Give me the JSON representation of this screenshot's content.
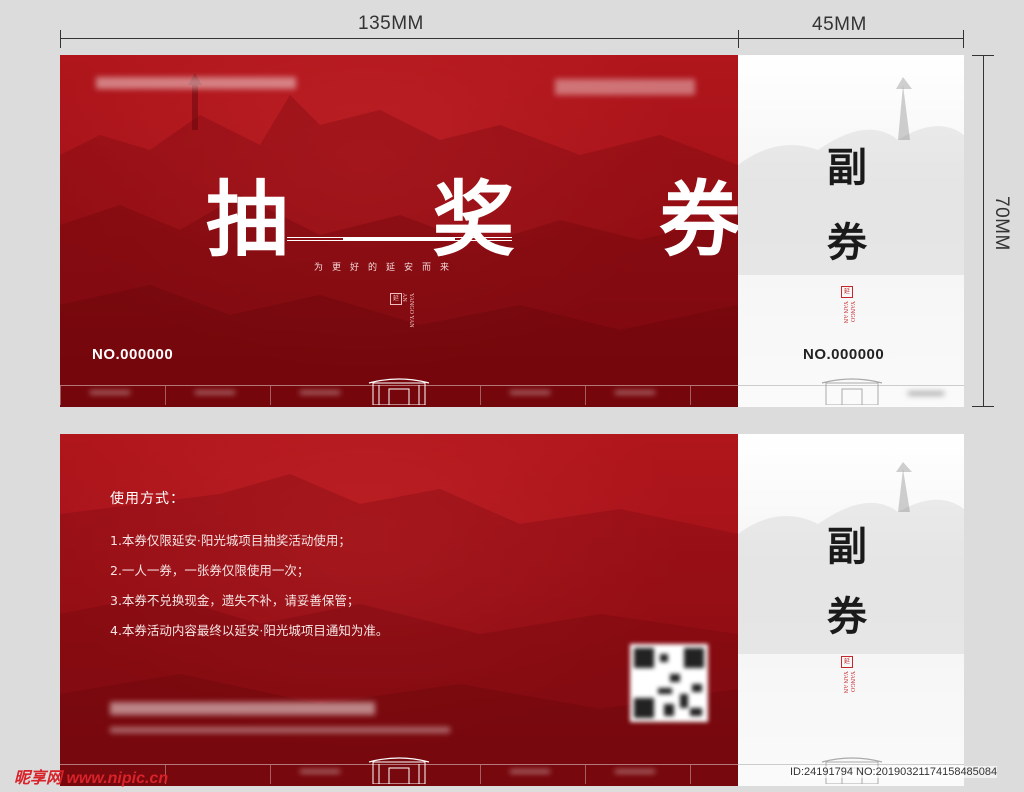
{
  "dimensions": {
    "width_main": "135MM",
    "width_stub": "45MM",
    "height": "70MM"
  },
  "front": {
    "title": "抽 奖 券",
    "subtitle": "为更好的延安而来",
    "number": "NO.000000",
    "stub_chars": [
      "副",
      "券"
    ],
    "stub_number": "NO.000000",
    "seal_text": "延",
    "seal_en": "YANGO YAN AN"
  },
  "back": {
    "usage_title": "使用方式：",
    "usage_items": [
      "1.本券仅限延安·阳光城项目抽奖活动使用；",
      "2.一人一券，一张券仅限使用一次；",
      "3.本券不兑换现金，遗失不补，请妥善保管；",
      "4.本券活动内容最终以延安·阳光城项目通知为准。"
    ],
    "stub_chars": [
      "副",
      "券"
    ],
    "seal_en": "YANGO YAN AN"
  },
  "watermark": {
    "site": "昵享网 www.nipic.cn",
    "id": "ID:24191794 NO:20190321174158485084"
  },
  "colors": {
    "background": "#dcdcdc",
    "ticket_red": "#a31218",
    "stub_white": "#ffffff",
    "seal_red": "#c4262c",
    "watermark_red": "#d8232a"
  }
}
